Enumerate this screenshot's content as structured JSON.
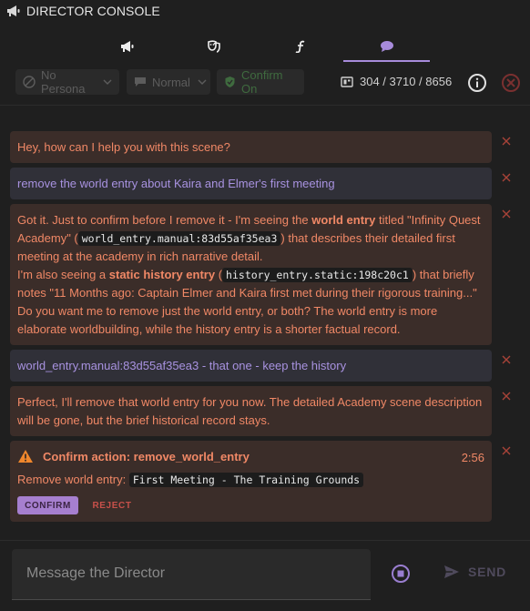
{
  "header": {
    "title": "DIRECTOR CONSOLE",
    "title_icon": "megaphone-icon"
  },
  "tabs": [
    {
      "icon": "megaphone-icon",
      "active": false
    },
    {
      "icon": "theater-masks-icon",
      "active": false
    },
    {
      "icon": "function-icon",
      "active": false
    },
    {
      "icon": "chat-bubble-icon",
      "active": true
    }
  ],
  "toolbar": {
    "persona_label": "No Persona",
    "mode_label": "Normal",
    "confirm_label": "Confirm On",
    "token_counter": "304 / 3710 / 8656",
    "accent_green": "#3f6b3f"
  },
  "messages": [
    {
      "role": "director",
      "text": "Hey, how can I help you with this scene?"
    },
    {
      "role": "user",
      "text": "remove the world entry about Kaira and Elmer's first meeting"
    },
    {
      "role": "director",
      "parts": {
        "p1a": "Got it. Just to confirm before I remove it - I'm seeing the ",
        "p1b": "world entry",
        "p1c": " titled \"Infinity Quest Academy\" (",
        "p1code": "world_entry.manual:83d55af35ea3",
        "p1d": ") that describes their detailed first meeting at the academy in rich narrative detail.",
        "p2a": "I'm also seeing a ",
        "p2b": "static history entry",
        "p2c": " (",
        "p2code": "history_entry.static:198c20c1",
        "p2d": ") that briefly notes \"11 Months ago: Captain Elmer and Kaira first met during their rigorous training...\"",
        "p3": "Do you want me to remove just the world entry, or both? The world entry is more elaborate worldbuilding, while the history entry is a shorter factual record."
      }
    },
    {
      "role": "user",
      "text": "world_entry.manual:83d55af35ea3 - that one - keep the history"
    },
    {
      "role": "director",
      "text": "Perfect, I'll remove that world entry for you now. The detailed Academy scene description will be gone, but the brief historical record stays."
    }
  ],
  "confirm_action": {
    "title": "Confirm action: remove_world_entry",
    "timer": "2:56",
    "label": "Remove world entry:",
    "entry_name": "First Meeting - The Training Grounds",
    "confirm_label": "CONFIRM",
    "reject_label": "REJECT"
  },
  "composer": {
    "placeholder": "Message the Director",
    "send_label": "SEND"
  },
  "colors": {
    "director_bg": "#3b2d29",
    "director_text": "#f08866",
    "user_bg": "#303038",
    "user_text": "#a892e0",
    "accent_purple": "#a78bdb"
  }
}
